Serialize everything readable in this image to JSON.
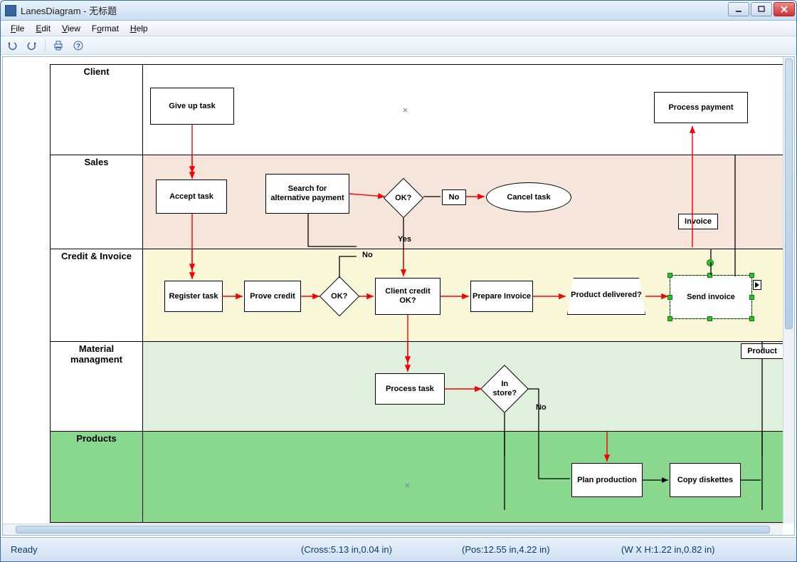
{
  "title": "LanesDiagram - 无标题",
  "menus": {
    "file": "File",
    "edit": "Edit",
    "view": "View",
    "format": "Format",
    "help": "Help"
  },
  "status": {
    "ready": "Ready",
    "cross": "(Cross:5.13 in,0.04 in)",
    "pos": "(Pos:12.55 in,4.22 in)",
    "size": "(W X H:1.22 in,0.82 in)"
  },
  "lanes": {
    "client": "Client",
    "sales": "Sales",
    "credit": "Credit & Invoice",
    "material": "Material managment",
    "products": "Products"
  },
  "nodes": {
    "give_up_task": "Give up task",
    "process_payment": "Process payment",
    "accept_task": "Accept task",
    "search_alt_payment": "Search for alternative payment",
    "ok_sales": "OK?",
    "no_sales": "No",
    "cancel_task": "Cancel task",
    "invoice_lbl": "Invoice",
    "yes_lbl": "Yes",
    "no_credit": "No",
    "register_task": "Register task",
    "prove_credit": "Prove credit",
    "ok_credit": "OK?",
    "client_credit_ok": "Client credit OK?",
    "prepare_invoice": "Prepare Invoice",
    "product_delivered": "Product delivered?",
    "send_invoice": "Send invoice",
    "product_lbl": "Product",
    "process_task": "Process task",
    "in_store": "In store?",
    "no_store": "No",
    "plan_production": "Plan production",
    "copy_diskettes": "Copy diskettes"
  }
}
